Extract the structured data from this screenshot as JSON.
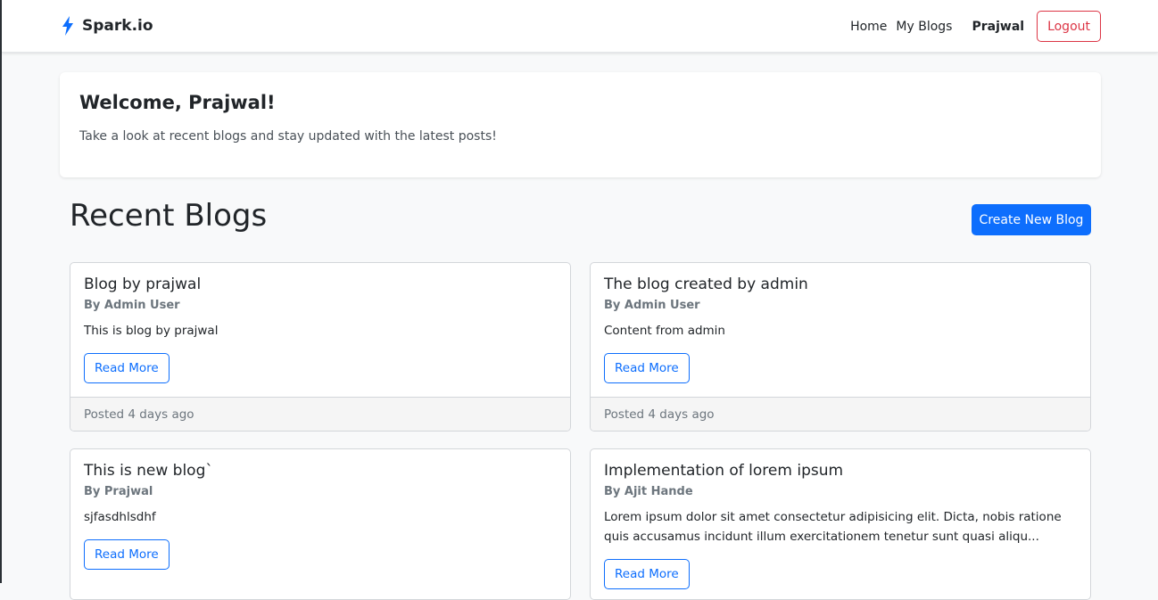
{
  "brand": {
    "name": "Spark.io",
    "icon": "lightning-icon",
    "icon_color": "#0d6efd"
  },
  "nav": {
    "links": [
      "Home",
      "My Blogs"
    ],
    "user": "Prajwal",
    "logout_label": "Logout"
  },
  "welcome": {
    "heading": "Welcome, Prajwal!",
    "text": "Take a look at recent blogs and stay updated with the latest posts!"
  },
  "blogs_section": {
    "title": "Recent Blogs",
    "create_label": "Create New Blog"
  },
  "blogs": [
    {
      "title": "Blog by prajwal",
      "author": "By Admin User",
      "excerpt": "This is blog by prajwal",
      "read_more": "Read More",
      "posted": "Posted 4 days ago"
    },
    {
      "title": "The blog created by admin",
      "author": "By Admin User",
      "excerpt": "Content from admin",
      "read_more": "Read More",
      "posted": "Posted 4 days ago"
    },
    {
      "title": "This is new blog`",
      "author": "By Prajwal",
      "excerpt": "sjfasdhlsdhf",
      "read_more": "Read More",
      "posted": ""
    },
    {
      "title": "Implementation of lorem ipsum",
      "author": "By Ajit Hande",
      "excerpt": "Lorem ipsum dolor sit amet consectetur adipisicing elit. Dicta, nobis ratione quis accusamus incidunt illum exercitationem tenetur sunt quasi aliqu...",
      "read_more": "Read More",
      "posted": ""
    }
  ],
  "colors": {
    "primary": "#0d6efd",
    "danger": "#dc3545",
    "background": "#f8f9fa"
  }
}
